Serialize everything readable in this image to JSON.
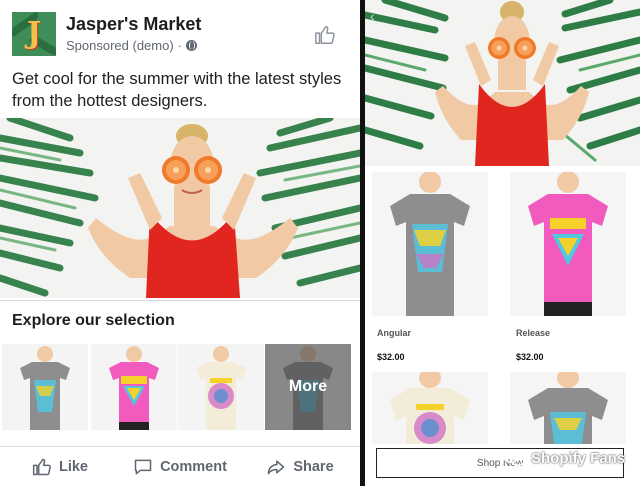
{
  "ad": {
    "page_name": "Jasper's Market",
    "sponsored": "Sponsored (demo)",
    "dot": "·",
    "caption": "Get cool for the summer with the latest styles from the hottest designers.",
    "section_title": "Explore our selection",
    "more_label": "More",
    "actions": {
      "like": "Like",
      "comment": "Comment",
      "share": "Share"
    }
  },
  "canvas": {
    "products": [
      {
        "name": "Angular",
        "price": "$32.00",
        "shirt": "grey"
      },
      {
        "name": "Release",
        "price": "$32.00",
        "shirt": "pink"
      },
      {
        "name": "",
        "price": "",
        "shirt": "cream"
      },
      {
        "name": "",
        "price": "",
        "shirt": "grey"
      }
    ],
    "shop_now": "Shop Now"
  },
  "watermark": "Shopify Fans",
  "colors": {
    "text_primary": "#1c1e21",
    "text_secondary": "#606770",
    "swimsuit_red": "#e0261e",
    "orange": "#f07a2a",
    "palm_green": "#2f7d46",
    "shirt_pink": "#f25bbd",
    "shirt_grey": "#8e8e90",
    "shirt_cream": "#f3ecd8",
    "print_cyan": "#54c7e0",
    "print_yellow": "#f4d22b"
  },
  "icons": [
    "jaspers-logo-icon",
    "globe-icon",
    "thumbs-up-icon",
    "comment-icon",
    "share-arrow-icon",
    "back-chevron-icon",
    "wechat-icon"
  ]
}
